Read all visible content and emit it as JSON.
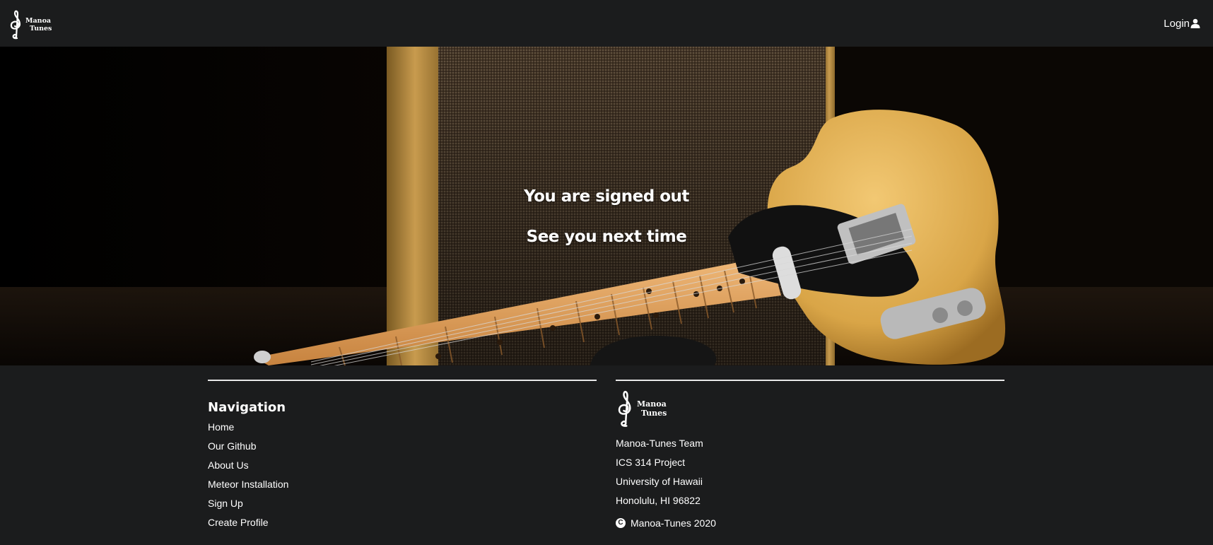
{
  "navbar": {
    "logo": {
      "line1": "Manoa",
      "line2": "Tunes",
      "icon": "treble-clef-icon"
    },
    "login": {
      "label": "Login",
      "icon": "user-icon"
    }
  },
  "hero": {
    "line1": "You are signed out",
    "line2": "See you next time"
  },
  "footer": {
    "navigation": {
      "title": "Navigation",
      "links": [
        "Home",
        "Our Github",
        "About Us",
        "Meteor Installation",
        "Sign Up",
        "Create Profile"
      ]
    },
    "about": {
      "logo": {
        "line1": "Manoa",
        "line2": "Tunes"
      },
      "lines": [
        "Manoa-Tunes Team",
        "ICS 314 Project",
        "University of Hawaii",
        "Honolulu, HI 96822"
      ],
      "copyright": "Manoa-Tunes 2020",
      "copyright_icon": "copyright-icon"
    }
  },
  "colors": {
    "background": "#1b1c1d",
    "text": "#ffffff",
    "guitar_body": "#e4b65a"
  }
}
